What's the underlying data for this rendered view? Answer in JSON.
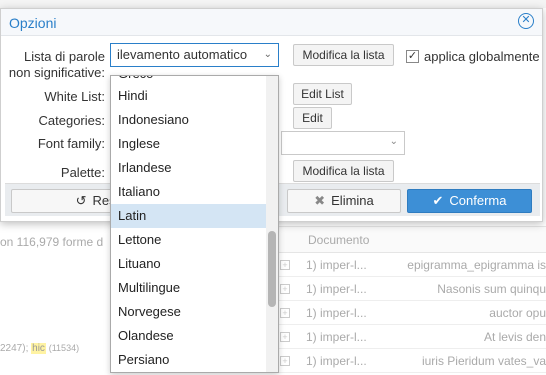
{
  "background": {
    "forms_text": "on 116,979 forme d",
    "tokens_prefix": "2247);",
    "token_highlight": "hic",
    "token_count": "(11534)",
    "table": {
      "header_col": "Documento",
      "rows": [
        {
          "doc": "1) imper-l...",
          "text": "epigramma_epigramma is"
        },
        {
          "doc": "1) imper-l...",
          "text": "Nasonis sum quinqu"
        },
        {
          "doc": "1) imper-l...",
          "text": "auctor opu"
        },
        {
          "doc": "1) imper-l...",
          "text": "At levis den"
        },
        {
          "doc": "1) imper-l...",
          "text": "iuris Pieridum vates_va"
        }
      ]
    }
  },
  "dialog": {
    "title": "Opzioni",
    "labels": {
      "stopwords_line1": "Lista di parole",
      "stopwords_line2": "non significative:",
      "whitelist": "White List:",
      "categories": "Categories:",
      "font_family": "Font family:",
      "palette": "Palette:"
    },
    "stopwords_select_value": "ilevamento automatico",
    "buttons": {
      "modify_list_1": "Modifica la lista",
      "edit_list": "Edit List",
      "edit": "Edit",
      "modify_list_2": "Modifica la lista"
    },
    "checkbox_label": "applica globalmente",
    "checkbox_checked": true,
    "footer": {
      "reset": "Reset",
      "delete": "Elimina",
      "confirm": "Conferma"
    },
    "dropdown": {
      "items": [
        "Greco",
        "Hindi",
        "Indonesiano",
        "Inglese",
        "Irlandese",
        "Italiano",
        "Latin",
        "Lettone",
        "Lituano",
        "Multilingue",
        "Norvegese",
        "Olandese",
        "Persiano"
      ],
      "selected": "Latin"
    }
  }
}
